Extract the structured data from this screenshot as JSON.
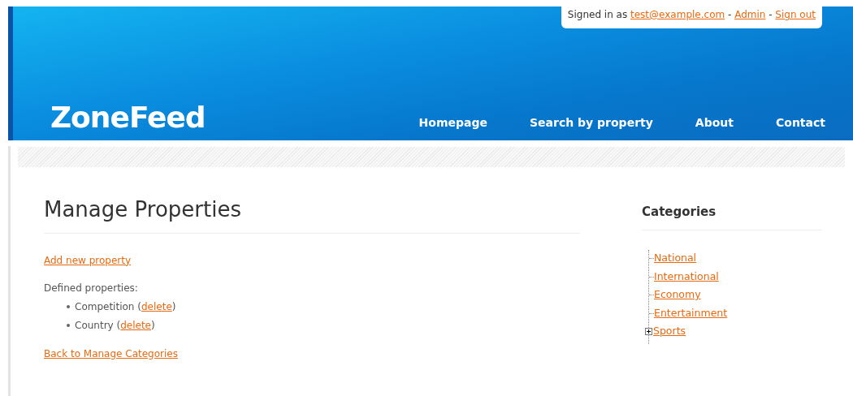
{
  "account": {
    "prefix": "Signed in as ",
    "links": [
      "test@example.com",
      "Admin",
      "Sign out"
    ],
    "separator": " - "
  },
  "logo": "ZoneFeed",
  "nav": [
    "Homepage",
    "Search by property",
    "About",
    "Contact"
  ],
  "main": {
    "title": "Manage Properties",
    "add_link": "Add new property",
    "list_label": "Defined properties:",
    "properties": [
      {
        "name": "Competition",
        "open": "(",
        "action": "delete",
        "close": ")"
      },
      {
        "name": "Country",
        "open": "(",
        "action": "delete",
        "close": ")"
      }
    ],
    "back_link": "Back to Manage Categories"
  },
  "sidebar": {
    "title": "Categories",
    "items": [
      {
        "label": "National",
        "kind": "leaf"
      },
      {
        "label": "International",
        "kind": "leaf"
      },
      {
        "label": "Economy",
        "kind": "leaf"
      },
      {
        "label": "Entertainment",
        "kind": "leaf"
      },
      {
        "label": "Sports",
        "kind": "collapsed"
      }
    ]
  }
}
